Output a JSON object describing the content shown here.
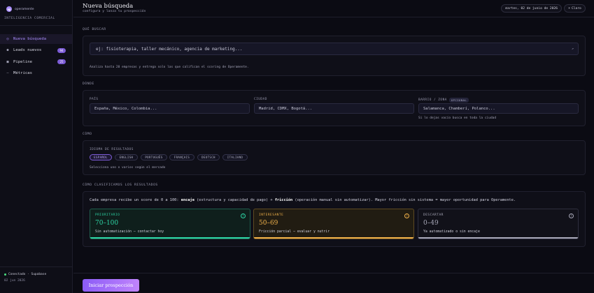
{
  "brand": {
    "logo_text": "op",
    "name": "operamente",
    "subtitle": "INTELIGENCIA COMERCIAL"
  },
  "sidebar": {
    "items": [
      {
        "label": "Nueva búsqueda",
        "icon": "circle-dot-icon",
        "active": true,
        "badge": ""
      },
      {
        "label": "Leads nuevos",
        "icon": "bullet-icon",
        "active": false,
        "badge": "94"
      },
      {
        "label": "Pipeline",
        "icon": "square-icon",
        "active": false,
        "badge": "25"
      },
      {
        "label": "Métricas",
        "icon": "dash-icon",
        "active": false,
        "badge": ""
      }
    ],
    "status": "Conectado · Supabase",
    "date": "02 jun 2026"
  },
  "header": {
    "title": "Nueva búsqueda",
    "subtitle": "configura y lanza tu prospección",
    "date": "martes, 02 de junio de 2026",
    "theme_label": "Claro"
  },
  "que_buscar": {
    "section_title": "QUÉ BUSCAR",
    "placeholder": "ej: fisioterapia, taller mecánico, agencia de marketing...",
    "hint": "Analiza hasta 20 empresas y entrega solo las que califican el scoring de Operamente."
  },
  "donde": {
    "section_title": "DÓNDE",
    "pais_label": "PAÍS",
    "pais_placeholder": "España, México, Colombia...",
    "ciudad_label": "CIUDAD",
    "ciudad_placeholder": "Madrid, CDMX, Bogotá...",
    "barrio_label": "BARRIO / ZONA",
    "opcional": "OPCIONAL",
    "barrio_placeholder": "Salamanca, Chamberí, Polanco...",
    "barrio_hint": "Si lo dejas vacío busca en toda la ciudad"
  },
  "como": {
    "section_title": "CÓMO",
    "idioma_label": "IDIOMA DE RESULTADOS",
    "languages": [
      "ESPAÑOL",
      "ENGLISH",
      "PORTUGUÊS",
      "FRANÇAIS",
      "DEUTSCH",
      "ITALIANO"
    ],
    "selected_language": "ESPAÑOL",
    "hint": "Selecciona uno o varios según el mercado"
  },
  "scoring": {
    "section_title": "CÓMO CLASIFICAMOS LOS RESULTADOS",
    "intro_a": "Cada empresa recibe un score de 0 a 100: ",
    "intro_b": "encaje",
    "intro_c": " (estructura y capacidad de pago) + ",
    "intro_d": "fricción",
    "intro_e": " (operación manual sin automatizar). Mayor fricción sin sistema = mayor oportunidad para Operamente.",
    "tiers": [
      {
        "label": "PRIORITARIO",
        "range": "70–100",
        "desc": "Sin automatización — contactar hoy",
        "color": "#2dd4a4"
      },
      {
        "label": "INTERESANTE",
        "range": "50–69",
        "desc": "Fricción parcial — evaluar y nutrir",
        "color": "#f0b14a"
      },
      {
        "label": "DESCARTAR",
        "range": "0–49",
        "desc": "Ya automatizado o sin encaje",
        "color": "#a8a8b8"
      }
    ]
  },
  "cta_label": "Iniciar prospección"
}
